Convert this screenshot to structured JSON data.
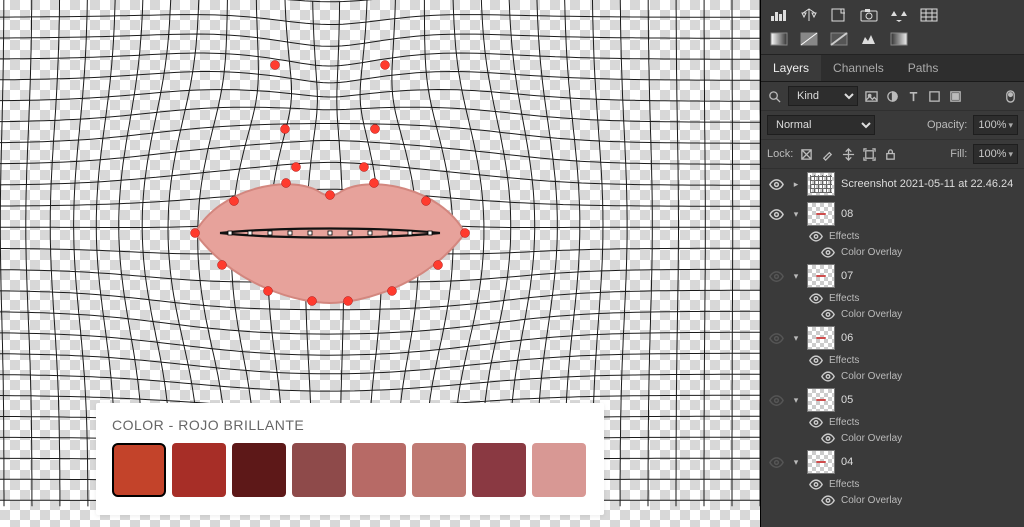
{
  "canvas": {
    "lip_fill": "#e7a29b",
    "lip_stroke": "#d3877f",
    "handle_color": "#ff3b2e"
  },
  "swatch_card": {
    "title": "COLOR - ROJO BRILLANTE",
    "colors": [
      "#c3432a",
      "#a72e27",
      "#5d1818",
      "#8e4a4a",
      "#b76a66",
      "#c07a73",
      "#8a3942",
      "#d89894"
    ],
    "selected_index": 0
  },
  "status_text": "",
  "panels": {
    "tabs": [
      "Layers",
      "Channels",
      "Paths"
    ],
    "active_tab": 0,
    "filter": {
      "kind_label": "Kind"
    },
    "blend_mode": "Normal",
    "opacity_label": "Opacity:",
    "opacity_value": "100%",
    "lock_label": "Lock:",
    "fill_label": "Fill:",
    "fill_value": "100%",
    "effects_label": "Effects",
    "overlay_label": "Color Overlay",
    "layers": [
      {
        "name": "Screenshot 2021-05-11 at 22.46.24",
        "thumb": "mesh",
        "visible": true,
        "arrow": ">",
        "effects": false
      },
      {
        "name": "08",
        "thumb": "lip",
        "visible": true,
        "arrow": "v",
        "effects": true
      },
      {
        "name": "07",
        "thumb": "lip",
        "visible": false,
        "arrow": "v",
        "effects": true
      },
      {
        "name": "06",
        "thumb": "lip",
        "visible": false,
        "arrow": "v",
        "effects": true
      },
      {
        "name": "05",
        "thumb": "lip",
        "visible": false,
        "arrow": "v",
        "effects": true
      },
      {
        "name": "04",
        "thumb": "lip",
        "visible": false,
        "arrow": "v",
        "effects": true
      }
    ]
  }
}
